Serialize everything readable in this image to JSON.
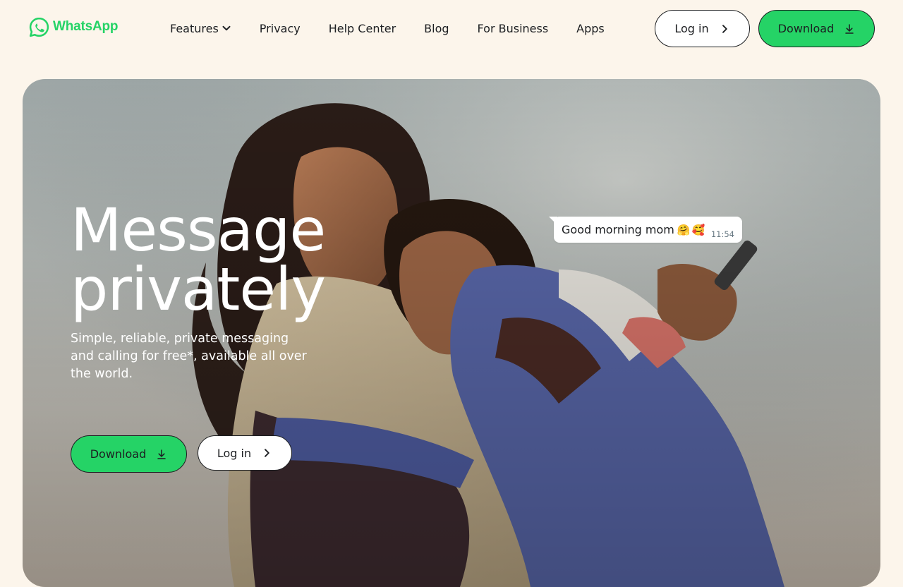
{
  "brand": {
    "name": "WhatsApp",
    "color": "#25D366"
  },
  "nav": {
    "items": [
      {
        "label": "Features",
        "has_dropdown": true
      },
      {
        "label": "Privacy"
      },
      {
        "label": "Help Center"
      },
      {
        "label": "Blog"
      },
      {
        "label": "For Business"
      },
      {
        "label": "Apps"
      }
    ]
  },
  "header_actions": {
    "login_label": "Log in",
    "download_label": "Download"
  },
  "hero": {
    "title_line1": "Message",
    "title_line2": "privately",
    "subtitle": "Simple, reliable, private messaging and calling for free*, available all over the world.",
    "download_label": "Download",
    "login_label": "Log in",
    "chat_bubble": {
      "text": "Good morning mom",
      "emoji": "🤗🥰",
      "time": "11:54"
    }
  },
  "icons": {
    "logo": "whatsapp-logo-icon",
    "features_dropdown": "chevron-down-icon",
    "login": "chevron-right-icon",
    "download": "download-icon"
  },
  "colors": {
    "page_background": "#FCF5EB",
    "accent_green": "#25D366",
    "text": "#1C1E21"
  }
}
